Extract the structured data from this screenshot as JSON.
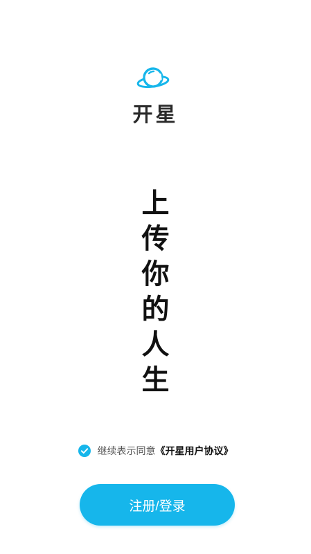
{
  "brand": {
    "icon": "planet-icon",
    "name": "开星",
    "accent_color": "#16b6eb"
  },
  "slogan": {
    "chars": [
      "上",
      "传",
      "你",
      "的",
      "人",
      "生"
    ]
  },
  "agreement": {
    "checked": true,
    "prefix": "继续表示同意",
    "link": "《开星用户协议》"
  },
  "actions": {
    "login_label": "注册/登录"
  }
}
